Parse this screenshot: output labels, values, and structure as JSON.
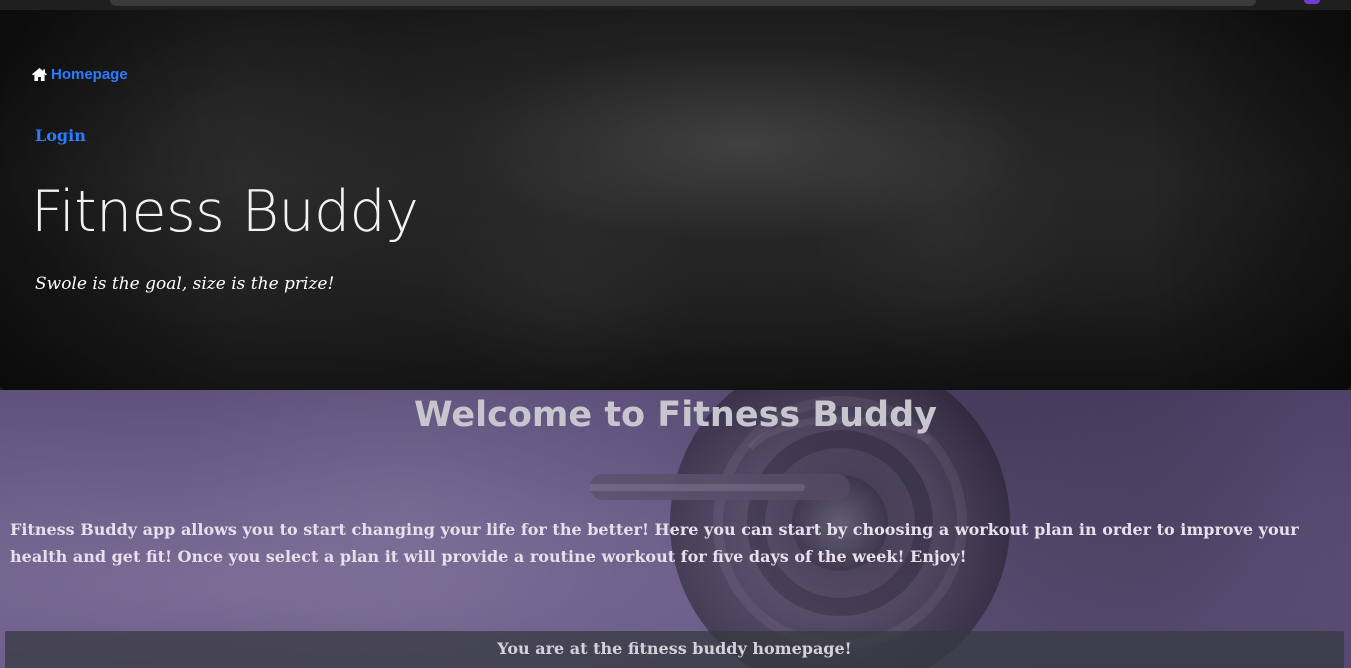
{
  "header": {
    "nav": {
      "homepage_label": "Homepage",
      "home_icon": "home-icon",
      "login_label": "Login"
    },
    "title": "Fitness Buddy",
    "tagline": "Swole is the goal, size is the prize!"
  },
  "main": {
    "heading": "Welcome to Fitness Buddy",
    "description": "Fitness Buddy app allows you to start changing your life for the better! Here you can start by choosing a workout plan in order to improve your health and get fit! Once you select a plan it will provide a routine workout for five days of the week! Enjoy!",
    "status": "You are at the fitness buddy homepage!"
  },
  "colors": {
    "link": "#2c7cff",
    "hero_background": "#1b1b1b",
    "main_background": "#6a5b88",
    "status_bar": "#373a42"
  }
}
